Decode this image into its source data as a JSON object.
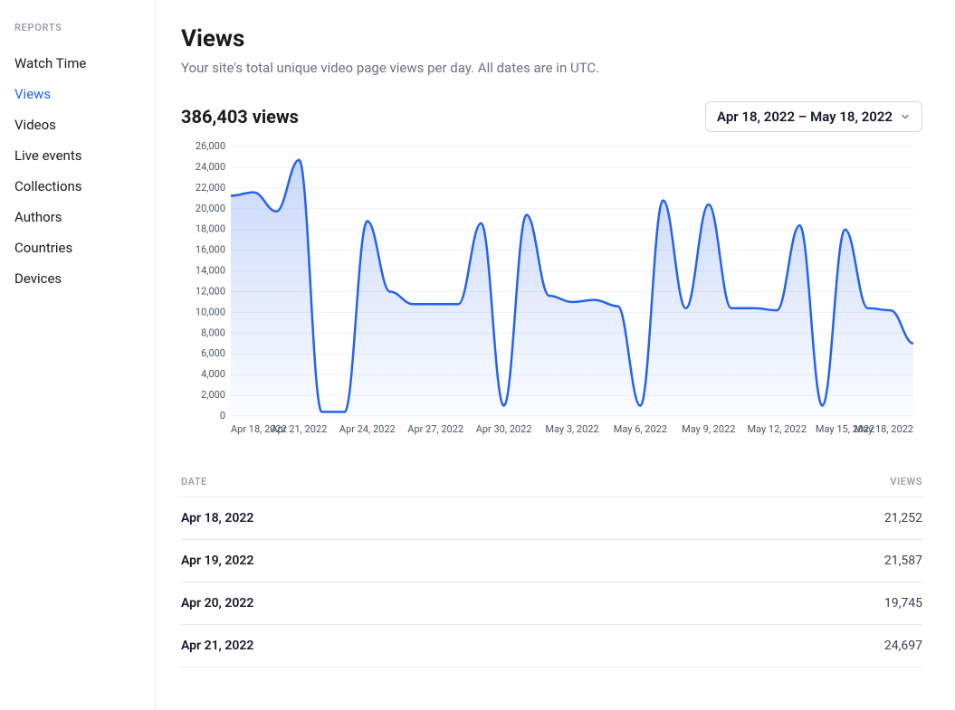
{
  "sidebar": {
    "heading": "REPORTS",
    "items": [
      {
        "label": "Watch Time",
        "active": false
      },
      {
        "label": "Views",
        "active": true
      },
      {
        "label": "Videos",
        "active": false
      },
      {
        "label": "Live events",
        "active": false
      },
      {
        "label": "Collections",
        "active": false
      },
      {
        "label": "Authors",
        "active": false
      },
      {
        "label": "Countries",
        "active": false
      },
      {
        "label": "Devices",
        "active": false
      }
    ]
  },
  "header": {
    "title": "Views",
    "subtitle": "Your site's total unique video page views per day. All dates are in UTC."
  },
  "summary": {
    "count_text": "386,403 views",
    "date_range": "Apr 18, 2022 – May 18, 2022"
  },
  "chart_data": {
    "type": "area",
    "title": "",
    "xlabel": "",
    "ylabel": "",
    "ylim": [
      0,
      26000
    ],
    "y_ticks": [
      0,
      2000,
      4000,
      6000,
      8000,
      10000,
      12000,
      14000,
      16000,
      18000,
      20000,
      22000,
      24000,
      26000
    ],
    "y_tick_labels": [
      "0",
      "2,000",
      "4,000",
      "6,000",
      "8,000",
      "10,000",
      "12,000",
      "14,000",
      "16,000",
      "18,000",
      "20,000",
      "22,000",
      "24,000",
      "26,000"
    ],
    "x_tick_labels": [
      "Apr 18, 2022",
      "Apr 21, 2022",
      "Apr 24, 2022",
      "Apr 27, 2022",
      "Apr 30, 2022",
      "May  3, 2022",
      "May  6, 2022",
      "May  9, 2022",
      "May 12, 2022",
      "May 15, 2022",
      "May 18, 2022"
    ],
    "categories": [
      "Apr 18, 2022",
      "Apr 19, 2022",
      "Apr 20, 2022",
      "Apr 21, 2022",
      "Apr 22, 2022",
      "Apr 23, 2022",
      "Apr 24, 2022",
      "Apr 25, 2022",
      "Apr 26, 2022",
      "Apr 27, 2022",
      "Apr 28, 2022",
      "Apr 29, 2022",
      "Apr 30, 2022",
      "May 1, 2022",
      "May 2, 2022",
      "May 3, 2022",
      "May 4, 2022",
      "May 5, 2022",
      "May 6, 2022",
      "May 7, 2022",
      "May 8, 2022",
      "May 9, 2022",
      "May 10, 2022",
      "May 11, 2022",
      "May 12, 2022",
      "May 13, 2022",
      "May 14, 2022",
      "May 15, 2022",
      "May 16, 2022",
      "May 17, 2022",
      "May 18, 2022"
    ],
    "values": [
      21252,
      21587,
      19745,
      24697,
      400,
      400,
      18800,
      12000,
      10800,
      10800,
      10800,
      18600,
      1000,
      19400,
      11600,
      11000,
      11200,
      10600,
      1000,
      20800,
      10400,
      20400,
      10400,
      10400,
      10200,
      18400,
      1000,
      18000,
      10400,
      10200,
      7000
    ],
    "series_color": "#2563eb"
  },
  "table": {
    "headers": {
      "date": "DATE",
      "views": "VIEWS"
    },
    "rows": [
      {
        "date": "Apr 18, 2022",
        "views": "21,252"
      },
      {
        "date": "Apr 19, 2022",
        "views": "21,587"
      },
      {
        "date": "Apr 20, 2022",
        "views": "19,745"
      },
      {
        "date": "Apr 21, 2022",
        "views": "24,697"
      }
    ]
  }
}
